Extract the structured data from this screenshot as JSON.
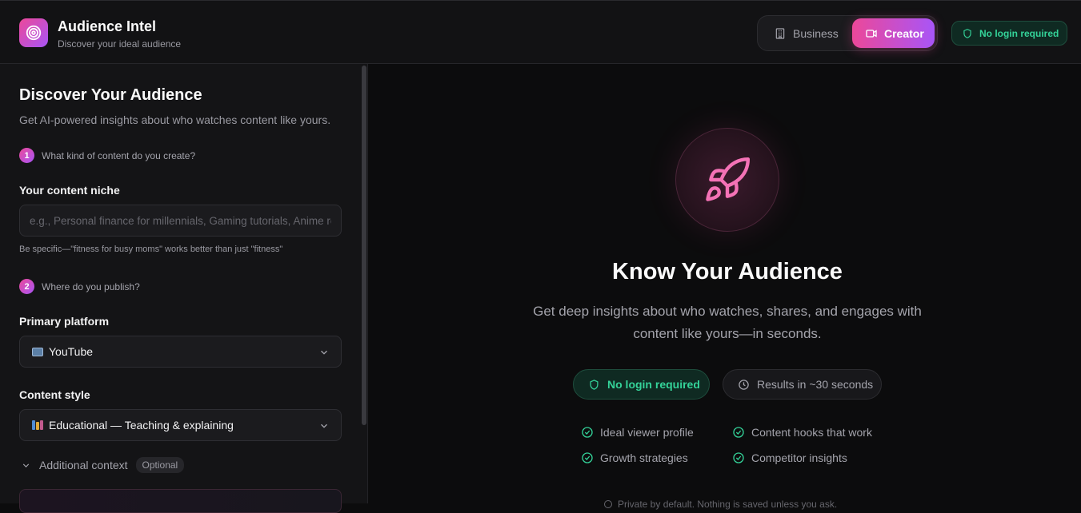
{
  "header": {
    "app_title": "Audience Intel",
    "app_subtitle": "Discover your ideal audience",
    "mode_business": "Business",
    "mode_creator": "Creator",
    "login_badge": "No login required"
  },
  "sidebar": {
    "title": "Discover Your Audience",
    "subtitle": "Get AI-powered insights about who watches content like yours.",
    "step1": {
      "num": "1",
      "text": "What kind of content do you create?"
    },
    "niche_label": "Your content niche",
    "niche_value": "",
    "niche_placeholder": "e.g., Personal finance for millennials, Gaming tutorials, Anime reviews",
    "niche_hint": "Be specific—\"fitness for busy moms\" works better than just \"fitness\"",
    "step2": {
      "num": "2",
      "text": "Where do you publish?"
    },
    "platform_label": "Primary platform",
    "platform_value": "YouTube",
    "style_label": "Content style",
    "style_value": "Educational — Teaching & explaining",
    "additional_label": "Additional context",
    "optional_pill": "Optional"
  },
  "main": {
    "hero_title": "Know Your Audience",
    "hero_subtitle": "Get deep insights about who watches, shares, and engages with content like yours—in seconds.",
    "pill_login": "No login required",
    "pill_time": "Results in ~30 seconds",
    "features": [
      "Ideal viewer profile",
      "Content hooks that work",
      "Growth strategies",
      "Competitor insights"
    ],
    "footer_note": "Private by default. Nothing is saved unless you ask."
  },
  "colors": {
    "accent_pink": "#ec4899",
    "accent_purple": "#a855f7",
    "success_green": "#34d399",
    "background": "#0c0c0d"
  },
  "icons": [
    "target-icon",
    "building-icon",
    "video-icon",
    "shield-icon",
    "chevron-down-icon",
    "rocket-icon",
    "clock-icon",
    "check-circle-icon"
  ]
}
